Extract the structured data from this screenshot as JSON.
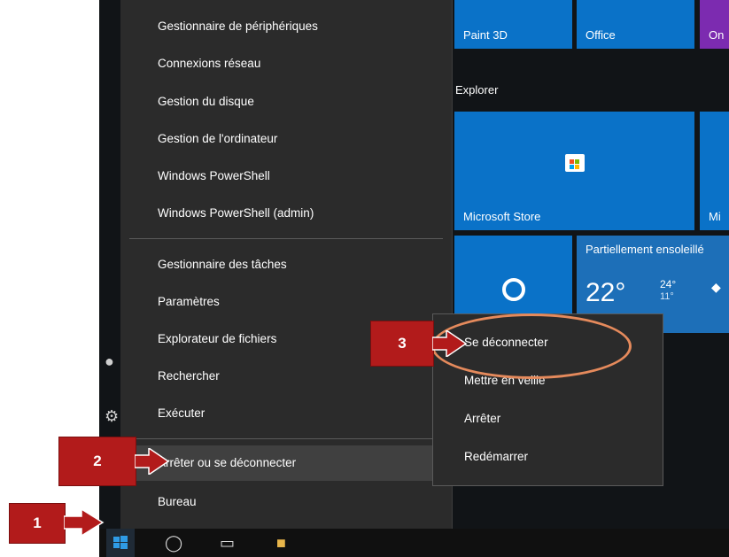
{
  "context_menu": {
    "items": [
      "Gestionnaire de périphériques",
      "Connexions réseau",
      "Gestion du disque",
      "Gestion de l'ordinateur",
      "Windows PowerShell",
      "Windows PowerShell (admin)",
      "Gestionnaire des tâches",
      "Paramètres",
      "Explorateur de fichiers",
      "Rechercher",
      "Exécuter",
      "Arrêter ou se déconnecter",
      "Bureau"
    ]
  },
  "submenu": {
    "items": [
      "Se déconnecter",
      "Mettre en veille",
      "Arrêter",
      "Redémarrer"
    ]
  },
  "tiles": {
    "paint3d": "Paint 3D",
    "office": "Office",
    "onenote_partial": "On",
    "section_explorer": "Explorer",
    "store": "Microsoft Store",
    "partial_mi": "Mi",
    "weather_title": "Partiellement ensoleillé",
    "weather_temp": "22°",
    "weather_high": "24°",
    "weather_low": "11°"
  },
  "callouts": [
    "1",
    "2",
    "3"
  ],
  "icons": [
    "windows-start-icon",
    "cortana-icon",
    "task-view-icon",
    "file-explorer-icon",
    "store-bag-icon",
    "map-pin-icon",
    "settings-icon",
    "user-icon",
    "chevron-right-icon"
  ],
  "colors": {
    "tile_blue": "#0a72c8",
    "menu_bg": "#2b2b2b",
    "callout_red": "#b21b1b",
    "highlight_oval": "#e58a5c"
  }
}
